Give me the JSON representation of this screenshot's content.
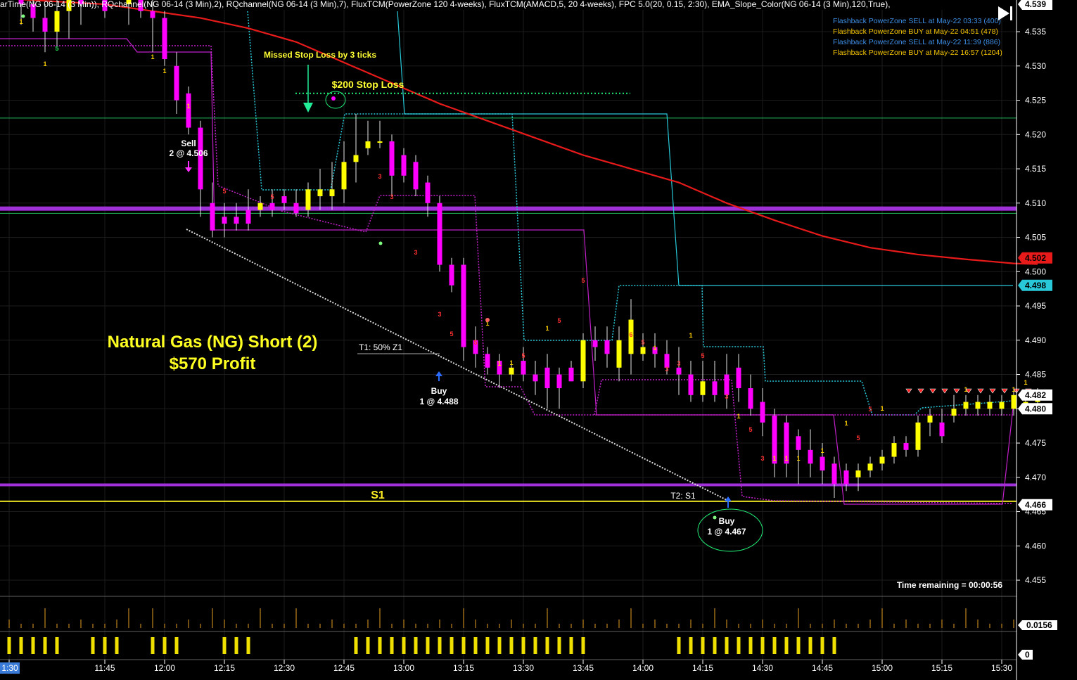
{
  "header": {
    "indicators": "arTime(NG 06-14 (3 Min)), RQchannel(NG 06-14 (3 Min),2), RQchannel(NG 06-14 (3 Min),7), FluxTCM(PowerZone 120 4-weeks), FluxTCM(AMACD,5, 20 4-weeks), FPC 5.0(20, 0.15, 2:30), EMA_Slope_Color(NG 06-14 (3 Min),120,True),"
  },
  "legend": [
    {
      "text": "Flashback PowerZone SELL at May-22 03:33 (400)",
      "color": "#3d8fe6"
    },
    {
      "text": "Flashback PowerZone BUY at May-22 04:51 (478)",
      "color": "#f2c200"
    },
    {
      "text": "Flashback PowerZone SELL at May-22 11:39 (886)",
      "color": "#3d8fe6"
    },
    {
      "text": "Flashback PowerZone BUY at May-22 16:57 (1204)",
      "color": "#f2c200"
    }
  ],
  "colors": {
    "bull": "#ffff00",
    "bear": "#ff00ff",
    "ema": "#e81a1a",
    "channel": "#28c8d8",
    "purple": "#a030d8",
    "annotation_yellow": "#ffff33",
    "green": "#22ee77",
    "grid": "#1c1c1c"
  },
  "chart_data": {
    "type": "candlestick",
    "title": "Natural Gas (NG) Short (2)",
    "subtitle": "$570 Profit",
    "symbol": "NG 06-14 (3 Min)",
    "y_axis": {
      "min": 4.45,
      "max": 4.54,
      "ticks": [
        "4.455",
        "4.460",
        "4.465",
        "4.470",
        "4.475",
        "4.480",
        "4.485",
        "4.490",
        "4.495",
        "4.500",
        "4.505",
        "4.510",
        "4.515",
        "4.520",
        "4.525",
        "4.530",
        "4.535"
      ]
    },
    "x_axis": {
      "ticks": [
        {
          "label": "1:30",
          "t": 0
        },
        {
          "label": "11:45",
          "t": 8
        },
        {
          "label": "12:00",
          "t": 13
        },
        {
          "label": "12:15",
          "t": 18
        },
        {
          "label": "12:30",
          "t": 23
        },
        {
          "label": "12:45",
          "t": 28
        },
        {
          "label": "13:00",
          "t": 33
        },
        {
          "label": "13:15",
          "t": 38
        },
        {
          "label": "13:30",
          "t": 43
        },
        {
          "label": "13:45",
          "t": 48
        },
        {
          "label": "14:00",
          "t": 53
        },
        {
          "label": "14:15",
          "t": 58
        },
        {
          "label": "14:30",
          "t": 63
        },
        {
          "label": "14:45",
          "t": 68
        },
        {
          "label": "15:00",
          "t": 73
        },
        {
          "label": "15:15",
          "t": 78
        },
        {
          "label": "15:30",
          "t": 83
        }
      ]
    },
    "price_tags": [
      {
        "label": "4.539",
        "value": 4.539,
        "color": "#ffffff"
      },
      {
        "label": "4.502",
        "value": 4.502,
        "color": "#e81a1a"
      },
      {
        "label": "4.498",
        "value": 4.498,
        "color": "#28c8d8"
      },
      {
        "label": "4.482",
        "value": 4.482,
        "color": "#ffffff"
      },
      {
        "label": "4.480",
        "value": 4.48,
        "color": "#ffffff"
      },
      {
        "label": "4.466",
        "value": 4.466,
        "color": "#ffffff"
      }
    ],
    "candles": [
      {
        "t": 1,
        "o": 4.54,
        "h": 4.542,
        "l": 4.536,
        "c": 4.539
      },
      {
        "t": 2,
        "o": 4.539,
        "h": 4.541,
        "l": 4.535,
        "c": 4.537
      },
      {
        "t": 3,
        "o": 4.537,
        "h": 4.539,
        "l": 4.532,
        "c": 4.535
      },
      {
        "t": 4,
        "o": 4.535,
        "h": 4.54,
        "l": 4.533,
        "c": 4.538
      },
      {
        "t": 5,
        "o": 4.538,
        "h": 4.542,
        "l": 4.534,
        "c": 4.541
      },
      {
        "t": 6,
        "o": 4.541,
        "h": 4.542,
        "l": 4.536,
        "c": 4.539
      },
      {
        "t": 8,
        "o": 4.54,
        "h": 4.542,
        "l": 4.537,
        "c": 4.538
      },
      {
        "t": 10,
        "o": 4.539,
        "h": 4.542,
        "l": 4.536,
        "c": 4.54
      },
      {
        "t": 11,
        "o": 4.54,
        "h": 4.542,
        "l": 4.537,
        "c": 4.538
      },
      {
        "t": 12,
        "o": 4.538,
        "h": 4.542,
        "l": 4.532,
        "c": 4.537
      },
      {
        "t": 13,
        "o": 4.537,
        "h": 4.538,
        "l": 4.53,
        "c": 4.531
      },
      {
        "t": 14,
        "o": 4.53,
        "h": 4.532,
        "l": 4.523,
        "c": 4.525
      },
      {
        "t": 15,
        "o": 4.526,
        "h": 4.527,
        "l": 4.52,
        "c": 4.521
      },
      {
        "t": 16,
        "o": 4.521,
        "h": 4.522,
        "l": 4.508,
        "c": 4.512
      },
      {
        "t": 17,
        "o": 4.51,
        "h": 4.513,
        "l": 4.505,
        "c": 4.506
      },
      {
        "t": 18,
        "o": 4.508,
        "h": 4.51,
        "l": 4.505,
        "c": 4.507
      },
      {
        "t": 19,
        "o": 4.508,
        "h": 4.51,
        "l": 4.506,
        "c": 4.507
      },
      {
        "t": 20,
        "o": 4.509,
        "h": 4.512,
        "l": 4.506,
        "c": 4.507
      },
      {
        "t": 21,
        "o": 4.509,
        "h": 4.511,
        "l": 4.508,
        "c": 4.51
      },
      {
        "t": 22,
        "o": 4.51,
        "h": 4.512,
        "l": 4.508,
        "c": 4.509
      },
      {
        "t": 23,
        "o": 4.511,
        "h": 4.512,
        "l": 4.509,
        "c": 4.51
      },
      {
        "t": 24,
        "o": 4.51,
        "h": 4.512,
        "l": 4.508,
        "c": 4.5085
      },
      {
        "t": 25,
        "o": 4.509,
        "h": 4.513,
        "l": 4.508,
        "c": 4.512
      },
      {
        "t": 26,
        "o": 4.511,
        "h": 4.515,
        "l": 4.509,
        "c": 4.512
      },
      {
        "t": 27,
        "o": 4.511,
        "h": 4.516,
        "l": 4.509,
        "c": 4.512
      },
      {
        "t": 28,
        "o": 4.512,
        "h": 4.519,
        "l": 4.51,
        "c": 4.516
      },
      {
        "t": 29,
        "o": 4.516,
        "h": 4.523,
        "l": 4.513,
        "c": 4.517
      },
      {
        "t": 30,
        "o": 4.518,
        "h": 4.522,
        "l": 4.517,
        "c": 4.519
      },
      {
        "t": 31,
        "o": 4.519,
        "h": 4.522,
        "l": 4.518,
        "c": 4.519
      },
      {
        "t": 32,
        "o": 4.519,
        "h": 4.52,
        "l": 4.511,
        "c": 4.514
      },
      {
        "t": 33,
        "o": 4.517,
        "h": 4.518,
        "l": 4.513,
        "c": 4.514
      },
      {
        "t": 34,
        "o": 4.516,
        "h": 4.517,
        "l": 4.511,
        "c": 4.512
      },
      {
        "t": 35,
        "o": 4.513,
        "h": 4.514,
        "l": 4.508,
        "c": 4.51
      },
      {
        "t": 36,
        "o": 4.51,
        "h": 4.511,
        "l": 4.5,
        "c": 4.501
      },
      {
        "t": 37,
        "o": 4.501,
        "h": 4.502,
        "l": 4.497,
        "c": 4.498
      },
      {
        "t": 38,
        "o": 4.501,
        "h": 4.502,
        "l": 4.487,
        "c": 4.489
      },
      {
        "t": 39,
        "o": 4.49,
        "h": 4.492,
        "l": 4.486,
        "c": 4.488
      },
      {
        "t": 40,
        "o": 4.488,
        "h": 4.489,
        "l": 4.485,
        "c": 4.486
      },
      {
        "t": 41,
        "o": 4.487,
        "h": 4.488,
        "l": 4.483,
        "c": 4.485
      },
      {
        "t": 42,
        "o": 4.485,
        "h": 4.487,
        "l": 4.484,
        "c": 4.486
      },
      {
        "t": 43,
        "o": 4.487,
        "h": 4.489,
        "l": 4.484,
        "c": 4.485
      },
      {
        "t": 44,
        "o": 4.485,
        "h": 4.487,
        "l": 4.482,
        "c": 4.484
      },
      {
        "t": 45,
        "o": 4.486,
        "h": 4.488,
        "l": 4.48,
        "c": 4.483
      },
      {
        "t": 46,
        "o": 4.485,
        "h": 4.486,
        "l": 4.48,
        "c": 4.483
      },
      {
        "t": 47,
        "o": 4.486,
        "h": 4.487,
        "l": 4.484,
        "c": 4.484
      },
      {
        "t": 48,
        "o": 4.484,
        "h": 4.491,
        "l": 4.483,
        "c": 4.49
      },
      {
        "t": 49,
        "o": 4.49,
        "h": 4.492,
        "l": 4.487,
        "c": 4.489
      },
      {
        "t": 50,
        "o": 4.49,
        "h": 4.492,
        "l": 4.486,
        "c": 4.488
      },
      {
        "t": 51,
        "o": 4.486,
        "h": 4.492,
        "l": 4.484,
        "c": 4.49
      },
      {
        "t": 52,
        "o": 4.488,
        "h": 4.496,
        "l": 4.485,
        "c": 4.493
      },
      {
        "t": 53,
        "o": 4.488,
        "h": 4.491,
        "l": 4.487,
        "c": 4.489
      },
      {
        "t": 54,
        "o": 4.489,
        "h": 4.491,
        "l": 4.486,
        "c": 4.488
      },
      {
        "t": 55,
        "o": 4.488,
        "h": 4.49,
        "l": 4.485,
        "c": 4.486
      },
      {
        "t": 56,
        "o": 4.486,
        "h": 4.489,
        "l": 4.482,
        "c": 4.485
      },
      {
        "t": 57,
        "o": 4.485,
        "h": 4.487,
        "l": 4.481,
        "c": 4.482
      },
      {
        "t": 58,
        "o": 4.482,
        "h": 4.487,
        "l": 4.481,
        "c": 4.484
      },
      {
        "t": 59,
        "o": 4.484,
        "h": 4.487,
        "l": 4.481,
        "c": 4.482
      },
      {
        "t": 60,
        "o": 4.485,
        "h": 4.488,
        "l": 4.48,
        "c": 4.482
      },
      {
        "t": 61,
        "o": 4.486,
        "h": 4.488,
        "l": 4.481,
        "c": 4.483
      },
      {
        "t": 62,
        "o": 4.483,
        "h": 4.485,
        "l": 4.479,
        "c": 4.48
      },
      {
        "t": 63,
        "o": 4.481,
        "h": 4.483,
        "l": 4.476,
        "c": 4.478
      },
      {
        "t": 64,
        "o": 4.479,
        "h": 4.48,
        "l": 4.47,
        "c": 4.472
      },
      {
        "t": 65,
        "o": 4.478,
        "h": 4.479,
        "l": 4.47,
        "c": 4.472
      },
      {
        "t": 66,
        "o": 4.476,
        "h": 4.477,
        "l": 4.469,
        "c": 4.474
      },
      {
        "t": 67,
        "o": 4.474,
        "h": 4.477,
        "l": 4.47,
        "c": 4.472
      },
      {
        "t": 68,
        "o": 4.473,
        "h": 4.475,
        "l": 4.469,
        "c": 4.471
      },
      {
        "t": 69,
        "o": 4.472,
        "h": 4.473,
        "l": 4.467,
        "c": 4.469
      },
      {
        "t": 70,
        "o": 4.471,
        "h": 4.472,
        "l": 4.468,
        "c": 4.469
      },
      {
        "t": 71,
        "o": 4.47,
        "h": 4.472,
        "l": 4.468,
        "c": 4.471
      },
      {
        "t": 72,
        "o": 4.471,
        "h": 4.473,
        "l": 4.47,
        "c": 4.472
      },
      {
        "t": 73,
        "o": 4.472,
        "h": 4.474,
        "l": 4.471,
        "c": 4.473
      },
      {
        "t": 74,
        "o": 4.473,
        "h": 4.476,
        "l": 4.472,
        "c": 4.475
      },
      {
        "t": 75,
        "o": 4.475,
        "h": 4.476,
        "l": 4.473,
        "c": 4.474
      },
      {
        "t": 76,
        "o": 4.474,
        "h": 4.479,
        "l": 4.473,
        "c": 4.478
      },
      {
        "t": 77,
        "o": 4.478,
        "h": 4.48,
        "l": 4.476,
        "c": 4.479
      },
      {
        "t": 78,
        "o": 4.478,
        "h": 4.48,
        "l": 4.475,
        "c": 4.476
      },
      {
        "t": 79,
        "o": 4.479,
        "h": 4.482,
        "l": 4.478,
        "c": 4.48
      },
      {
        "t": 80,
        "o": 4.48,
        "h": 4.482,
        "l": 4.479,
        "c": 4.481
      },
      {
        "t": 81,
        "o": 4.48,
        "h": 4.482,
        "l": 4.479,
        "c": 4.481
      },
      {
        "t": 82,
        "o": 4.48,
        "h": 4.482,
        "l": 4.479,
        "c": 4.481
      },
      {
        "t": 83,
        "o": 4.48,
        "h": 4.482,
        "l": 4.479,
        "c": 4.481
      },
      {
        "t": 84,
        "o": 4.48,
        "h": 4.483,
        "l": 4.479,
        "c": 4.482
      },
      {
        "t": 85,
        "o": 4.481,
        "h": 4.482,
        "l": 4.48,
        "c": 4.481
      },
      {
        "t": 86,
        "o": 4.481,
        "h": 4.483,
        "l": 4.48,
        "c": 4.482
      }
    ],
    "levels": [
      {
        "name": "purple-resistance",
        "value": 4.5092
      },
      {
        "name": "green-line",
        "value": 4.5224
      },
      {
        "name": "green-line-lower",
        "value": 4.5085
      },
      {
        "name": "s1-purple",
        "value": 4.4689
      },
      {
        "name": "s1-yellow",
        "value": 4.4665
      }
    ],
    "ema": [
      [
        0,
        4.5398
      ],
      [
        8,
        4.539
      ],
      [
        16,
        4.537
      ],
      [
        20,
        4.5355
      ],
      [
        24,
        4.5335
      ],
      [
        28,
        4.5305
      ],
      [
        32,
        4.5275
      ],
      [
        36,
        4.5245
      ],
      [
        40,
        4.522
      ],
      [
        44,
        4.5195
      ],
      [
        48,
        4.517
      ],
      [
        52,
        4.515
      ],
      [
        56,
        4.513
      ],
      [
        60,
        4.51
      ],
      [
        64,
        4.5075
      ],
      [
        68,
        4.5052
      ],
      [
        72,
        4.5035
      ],
      [
        76,
        4.5025
      ],
      [
        80,
        4.5018
      ],
      [
        84,
        4.5012
      ],
      [
        86,
        4.5011
      ]
    ],
    "annotations": {
      "missed_stop": "Missed Stop Loss by 3 ticks",
      "stop_loss": "$200 Stop Loss",
      "stop_loss_value": 4.526,
      "sell_label": "Sell",
      "sell_fill": "2 @ 4.506",
      "buy1_label": "Buy",
      "buy1_fill": "1 @ 4.488",
      "buy2_label": "Buy",
      "buy2_fill": "1 @ 4.467",
      "t1": "T1: 50% Z1",
      "t2": "T2: S1",
      "s1": "S1",
      "time_remaining": "Time remaining = 00:00:56"
    },
    "indicator_panels": {
      "volume_tag": "0.0156",
      "signal_tag": "0"
    }
  }
}
